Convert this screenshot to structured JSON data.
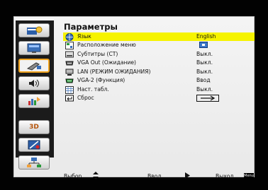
{
  "menu": {
    "title": "Параметры",
    "items": [
      {
        "label": "Язык",
        "value": "English",
        "icon": "globe-icon",
        "selected": true
      },
      {
        "label": "Расположение меню",
        "value": "",
        "icon": "menu-position-icon",
        "selected": false
      },
      {
        "label": "Субтитры (CT)",
        "value": "Выкл.",
        "icon": "subtitles-icon",
        "selected": false
      },
      {
        "label": "VGA Out (Ожидание)",
        "value": "Выкл.",
        "icon": "vga-out-icon",
        "selected": false
      },
      {
        "label": "LAN (РЕЖИМ ОЖИДАНИЯ)",
        "value": "Выкл.",
        "icon": "lan-icon",
        "selected": false
      },
      {
        "label": "VGA-2 (Функция)",
        "value": "Ввод",
        "icon": "vga2-icon",
        "selected": false
      },
      {
        "label": "Наст. табл.",
        "value": "Выкл.",
        "icon": "test-pattern-icon",
        "selected": false
      },
      {
        "label": "Сброс",
        "value": "",
        "icon": "reset-icon",
        "selected": false
      }
    ]
  },
  "sidebar": [
    {
      "name": "image-settings-icon",
      "active": false
    },
    {
      "name": "display-icon",
      "active": false
    },
    {
      "name": "setup-icon",
      "active": true
    },
    {
      "name": "audio-icon",
      "active": false
    },
    {
      "name": "options-icon",
      "active": false
    },
    {
      "name": "3d-icon",
      "text": "3D",
      "active": false
    },
    {
      "name": "lamp-icon",
      "active": false
    },
    {
      "name": "network-icon",
      "active": false
    }
  ],
  "footer": {
    "select": "Выбор",
    "enter": "Ввод",
    "exit": "Выход",
    "menu_badge": "Menu"
  },
  "colors": {
    "highlight": "#f6f300",
    "active_border": "#f0a21c",
    "background": "#020202"
  }
}
